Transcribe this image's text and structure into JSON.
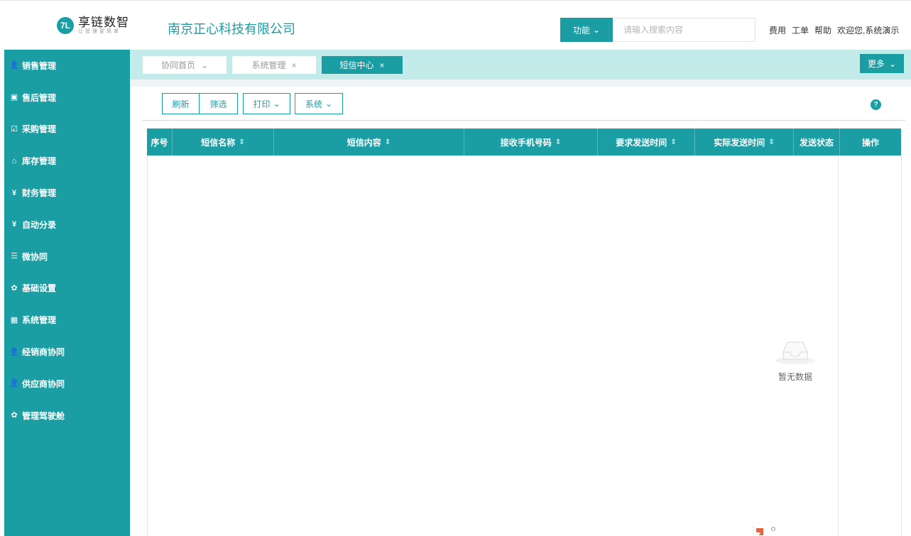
{
  "header": {
    "logo_mark": "7L",
    "logo_name": "享链数智",
    "logo_slogan": "让管理更简单",
    "company": "南京正心科技有限公司",
    "func_label": "功能",
    "search_placeholder": "请输入搜索内容",
    "links": [
      "费用",
      "工单",
      "帮助",
      "欢迎您,系统演示"
    ]
  },
  "sidebar": {
    "items": [
      {
        "label": "销售管理",
        "icon": "person-icon",
        "glyph": "👤"
      },
      {
        "label": "售后管理",
        "icon": "id-card-icon",
        "glyph": "▣"
      },
      {
        "label": "采购管理",
        "icon": "checkbox-icon",
        "glyph": "☑"
      },
      {
        "label": "库存管理",
        "icon": "home-icon",
        "glyph": "⌂"
      },
      {
        "label": "财务管理",
        "icon": "yen-icon",
        "glyph": "¥"
      },
      {
        "label": "自动分录",
        "icon": "yen-icon",
        "glyph": "¥"
      },
      {
        "label": "微协同",
        "icon": "message-icon",
        "glyph": "☰"
      },
      {
        "label": "基础设置",
        "icon": "gear-icon",
        "glyph": "✿"
      },
      {
        "label": "系统管理",
        "icon": "grid-icon",
        "glyph": "▦"
      },
      {
        "label": "经销商协同",
        "icon": "person-icon",
        "glyph": "👤"
      },
      {
        "label": "供应商协同",
        "icon": "person-icon",
        "glyph": "👤"
      },
      {
        "label": "管理驾驶舱",
        "icon": "gear-icon",
        "glyph": "✿"
      }
    ]
  },
  "tabs": [
    {
      "label": "协同首页",
      "suffix": "⌄",
      "active": false
    },
    {
      "label": "系统管理",
      "suffix": "×",
      "active": false
    },
    {
      "label": "短信中心",
      "suffix": "×",
      "active": true
    }
  ],
  "more_label": "更多",
  "toolbar": {
    "refresh": "刷新",
    "filter": "筛选",
    "print": "打印",
    "system": "系统"
  },
  "table": {
    "columns": [
      {
        "label": "序号",
        "sortable": false
      },
      {
        "label": "短信名称",
        "sortable": true
      },
      {
        "label": "短信内容",
        "sortable": true
      },
      {
        "label": "接收手机号码",
        "sortable": true
      },
      {
        "label": "要求发送时间",
        "sortable": true
      },
      {
        "label": "实际发送时间",
        "sortable": true
      },
      {
        "label": "发送状态",
        "sortable": false
      },
      {
        "label": "操作",
        "sortable": false
      }
    ],
    "rows": [],
    "empty_text": "暂无数据"
  },
  "colors": {
    "accent": "#1a9ea4",
    "tabbar_bg": "#c2ebea"
  }
}
